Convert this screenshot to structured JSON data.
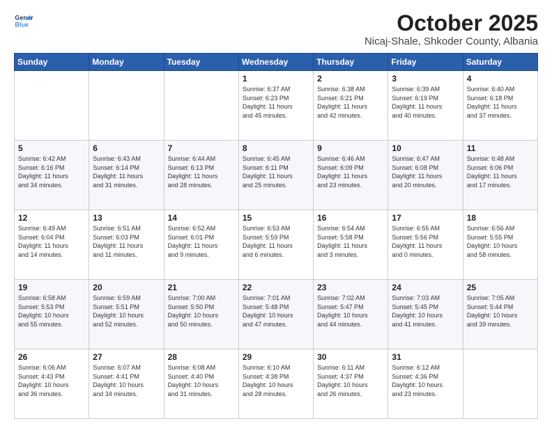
{
  "header": {
    "logo": {
      "line1": "General",
      "line2": "Blue"
    },
    "title": "October 2025",
    "subtitle": "Nicaj-Shale, Shkoder County, Albania"
  },
  "days_of_week": [
    "Sunday",
    "Monday",
    "Tuesday",
    "Wednesday",
    "Thursday",
    "Friday",
    "Saturday"
  ],
  "weeks": [
    [
      {
        "day": "",
        "info": ""
      },
      {
        "day": "",
        "info": ""
      },
      {
        "day": "",
        "info": ""
      },
      {
        "day": "1",
        "info": "Sunrise: 6:37 AM\nSunset: 6:23 PM\nDaylight: 11 hours\nand 45 minutes."
      },
      {
        "day": "2",
        "info": "Sunrise: 6:38 AM\nSunset: 6:21 PM\nDaylight: 11 hours\nand 42 minutes."
      },
      {
        "day": "3",
        "info": "Sunrise: 6:39 AM\nSunset: 6:19 PM\nDaylight: 11 hours\nand 40 minutes."
      },
      {
        "day": "4",
        "info": "Sunrise: 6:40 AM\nSunset: 6:18 PM\nDaylight: 11 hours\nand 37 minutes."
      }
    ],
    [
      {
        "day": "5",
        "info": "Sunrise: 6:42 AM\nSunset: 6:16 PM\nDaylight: 11 hours\nand 34 minutes."
      },
      {
        "day": "6",
        "info": "Sunrise: 6:43 AM\nSunset: 6:14 PM\nDaylight: 11 hours\nand 31 minutes."
      },
      {
        "day": "7",
        "info": "Sunrise: 6:44 AM\nSunset: 6:13 PM\nDaylight: 11 hours\nand 28 minutes."
      },
      {
        "day": "8",
        "info": "Sunrise: 6:45 AM\nSunset: 6:11 PM\nDaylight: 11 hours\nand 25 minutes."
      },
      {
        "day": "9",
        "info": "Sunrise: 6:46 AM\nSunset: 6:09 PM\nDaylight: 11 hours\nand 23 minutes."
      },
      {
        "day": "10",
        "info": "Sunrise: 6:47 AM\nSunset: 6:08 PM\nDaylight: 11 hours\nand 20 minutes."
      },
      {
        "day": "11",
        "info": "Sunrise: 6:48 AM\nSunset: 6:06 PM\nDaylight: 11 hours\nand 17 minutes."
      }
    ],
    [
      {
        "day": "12",
        "info": "Sunrise: 6:49 AM\nSunset: 6:04 PM\nDaylight: 11 hours\nand 14 minutes."
      },
      {
        "day": "13",
        "info": "Sunrise: 6:51 AM\nSunset: 6:03 PM\nDaylight: 11 hours\nand 11 minutes."
      },
      {
        "day": "14",
        "info": "Sunrise: 6:52 AM\nSunset: 6:01 PM\nDaylight: 11 hours\nand 9 minutes."
      },
      {
        "day": "15",
        "info": "Sunrise: 6:53 AM\nSunset: 5:59 PM\nDaylight: 11 hours\nand 6 minutes."
      },
      {
        "day": "16",
        "info": "Sunrise: 6:54 AM\nSunset: 5:58 PM\nDaylight: 11 hours\nand 3 minutes."
      },
      {
        "day": "17",
        "info": "Sunrise: 6:55 AM\nSunset: 5:56 PM\nDaylight: 11 hours\nand 0 minutes."
      },
      {
        "day": "18",
        "info": "Sunrise: 6:56 AM\nSunset: 5:55 PM\nDaylight: 10 hours\nand 58 minutes."
      }
    ],
    [
      {
        "day": "19",
        "info": "Sunrise: 6:58 AM\nSunset: 5:53 PM\nDaylight: 10 hours\nand 55 minutes."
      },
      {
        "day": "20",
        "info": "Sunrise: 6:59 AM\nSunset: 5:51 PM\nDaylight: 10 hours\nand 52 minutes."
      },
      {
        "day": "21",
        "info": "Sunrise: 7:00 AM\nSunset: 5:50 PM\nDaylight: 10 hours\nand 50 minutes."
      },
      {
        "day": "22",
        "info": "Sunrise: 7:01 AM\nSunset: 5:48 PM\nDaylight: 10 hours\nand 47 minutes."
      },
      {
        "day": "23",
        "info": "Sunrise: 7:02 AM\nSunset: 5:47 PM\nDaylight: 10 hours\nand 44 minutes."
      },
      {
        "day": "24",
        "info": "Sunrise: 7:03 AM\nSunset: 5:45 PM\nDaylight: 10 hours\nand 41 minutes."
      },
      {
        "day": "25",
        "info": "Sunrise: 7:05 AM\nSunset: 5:44 PM\nDaylight: 10 hours\nand 39 minutes."
      }
    ],
    [
      {
        "day": "26",
        "info": "Sunrise: 6:06 AM\nSunset: 4:43 PM\nDaylight: 10 hours\nand 36 minutes."
      },
      {
        "day": "27",
        "info": "Sunrise: 6:07 AM\nSunset: 4:41 PM\nDaylight: 10 hours\nand 34 minutes."
      },
      {
        "day": "28",
        "info": "Sunrise: 6:08 AM\nSunset: 4:40 PM\nDaylight: 10 hours\nand 31 minutes."
      },
      {
        "day": "29",
        "info": "Sunrise: 6:10 AM\nSunset: 4:38 PM\nDaylight: 10 hours\nand 28 minutes."
      },
      {
        "day": "30",
        "info": "Sunrise: 6:11 AM\nSunset: 4:37 PM\nDaylight: 10 hours\nand 26 minutes."
      },
      {
        "day": "31",
        "info": "Sunrise: 6:12 AM\nSunset: 4:36 PM\nDaylight: 10 hours\nand 23 minutes."
      },
      {
        "day": "",
        "info": ""
      }
    ]
  ]
}
